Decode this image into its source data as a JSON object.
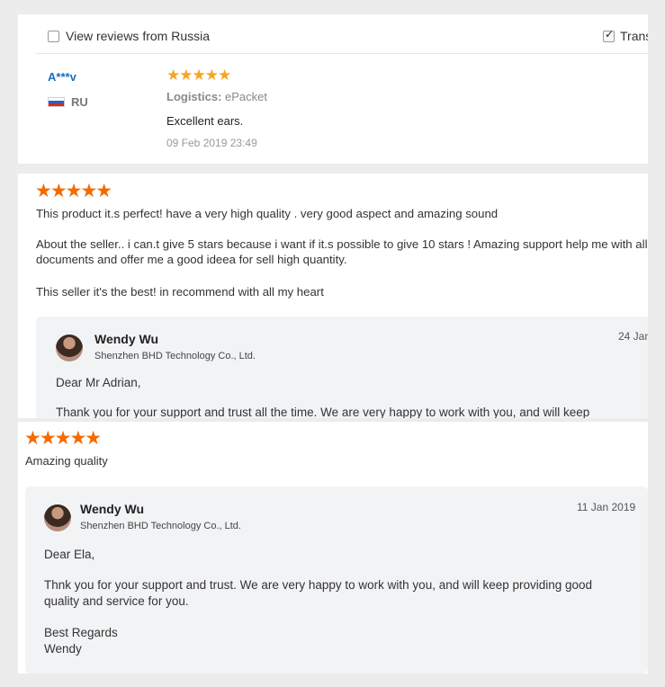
{
  "filters": {
    "country_label": "View reviews from Russia",
    "country_checked": false,
    "translate_label": "Trans",
    "translate_checked": true
  },
  "review1": {
    "user": "A***v",
    "country": "RU",
    "rating": 5,
    "stars": "★★★★★",
    "logistics_label": "Logistics:",
    "logistics_value": "ePacket",
    "feedback": "Excellent ears.",
    "date": "09 Feb 2019 23:49"
  },
  "review2": {
    "rating": 5,
    "stars": "★★★★★",
    "para1": "This product it.s perfect! have a very high quality . very good aspect and amazing sound",
    "para2": "About the seller.. i can.t give 5 stars  because i want if it.s possible to give 10 stars ! Amazing support  help me with all documents and offer me a good ideea for sell  high quantity.",
    "para3": "This seller it's the best! in recommend with all my heart",
    "reply": {
      "name": "Wendy Wu",
      "company": "Shenzhen BHD Technology Co., Ltd.",
      "date": "24 Jan",
      "greeting": "Dear Mr Adrian,",
      "body": "Thank you for your support and trust all the time.  We are very happy to work with you, and will keep"
    }
  },
  "review3": {
    "rating": 5,
    "stars": "★★★★★",
    "feedback": "Amazing quality",
    "reply": {
      "name": "Wendy Wu",
      "company": "Shenzhen BHD Technology Co., Ltd.",
      "date": "11 Jan 2019",
      "greeting": "Dear Ela,",
      "body": "Thnk you for your support and trust.  We are very happy to work with you, and will keep providing good quality and service for you.",
      "closing1": "Best Regards",
      "closing2": "Wendy"
    }
  },
  "colors": {
    "star_small": "#f6a623",
    "star_large": "#f56a00",
    "username": "#1c6dbd",
    "reply_bg": "#f2f3f5"
  }
}
